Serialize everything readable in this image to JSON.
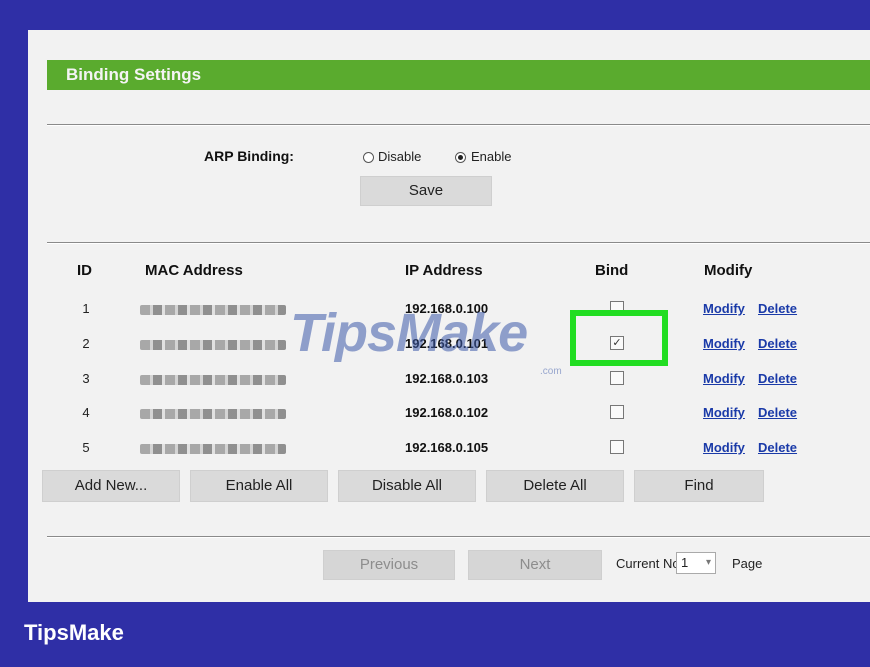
{
  "section_title": "Binding Settings",
  "arp": {
    "label": "ARP Binding:",
    "options": [
      "Disable",
      "Enable"
    ],
    "selected": "Enable",
    "save_label": "Save"
  },
  "table": {
    "headers": [
      "ID",
      "MAC Address",
      "IP Address",
      "Bind",
      "Modify"
    ],
    "rows": [
      {
        "id": "1",
        "ip": "192.168.0.100",
        "bound": false,
        "modify": "Modify",
        "delete": "Delete"
      },
      {
        "id": "2",
        "ip": "192.168.0.101",
        "bound": true,
        "modify": "Modify",
        "delete": "Delete"
      },
      {
        "id": "3",
        "ip": "192.168.0.103",
        "bound": false,
        "modify": "Modify",
        "delete": "Delete"
      },
      {
        "id": "4",
        "ip": "192.168.0.102",
        "bound": false,
        "modify": "Modify",
        "delete": "Delete"
      },
      {
        "id": "5",
        "ip": "192.168.0.105",
        "bound": false,
        "modify": "Modify",
        "delete": "Delete"
      }
    ]
  },
  "actions": {
    "add_new": "Add New...",
    "enable_all": "Enable All",
    "disable_all": "Disable All",
    "delete_all": "Delete All",
    "find": "Find"
  },
  "pager": {
    "previous": "Previous",
    "next": "Next",
    "current_label": "Current No.",
    "current_value": "1",
    "page_label": "Page"
  },
  "watermark": {
    "text": "TipsMake",
    "small": ".com"
  },
  "footer_brand": "TipsMake",
  "colors": {
    "header_green": "#5aab2e",
    "frame_blue": "#2f2fa6",
    "highlight": "#22dd22",
    "link": "#1a3aa8"
  }
}
